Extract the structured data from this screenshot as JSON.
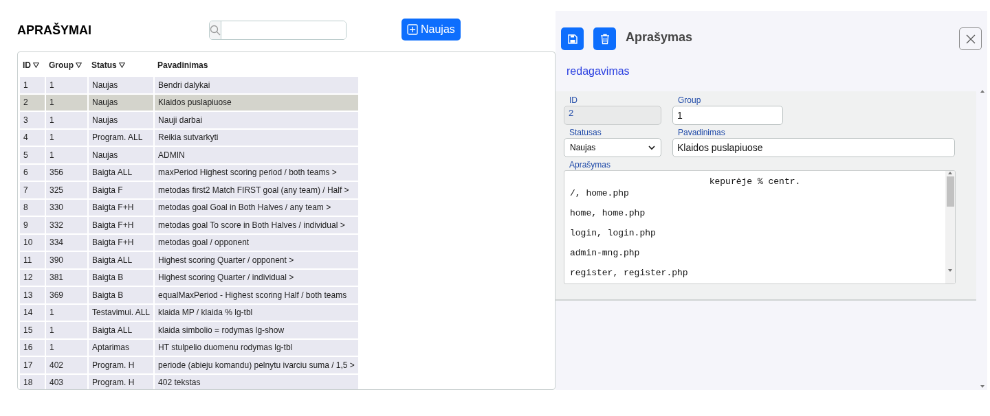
{
  "page": {
    "title": "APRAŠYMAI",
    "new_button": "Naujas"
  },
  "table": {
    "columns": [
      {
        "label": "ID",
        "sortable": true
      },
      {
        "label": "Group",
        "sortable": true
      },
      {
        "label": "Status",
        "sortable": true
      },
      {
        "label": "Pavadinimas",
        "sortable": false
      }
    ],
    "rows": [
      {
        "cells": [
          "1",
          "1",
          "Naujas",
          "Bendri dalykai"
        ],
        "selected": false
      },
      {
        "cells": [
          "2",
          "1",
          "Naujas",
          "Klaidos puslapiuose"
        ],
        "selected": true
      },
      {
        "cells": [
          "3",
          "1",
          "Naujas",
          "Nauji darbai"
        ],
        "selected": false
      },
      {
        "cells": [
          "4",
          "1",
          "Program. ALL",
          "Reikia sutvarkyti"
        ],
        "selected": false
      },
      {
        "cells": [
          "5",
          "1",
          "Naujas",
          "ADMIN"
        ],
        "selected": false
      },
      {
        "cells": [
          "6",
          "356",
          "Baigta ALL",
          "maxPeriod Highest scoring period / both teams >"
        ],
        "selected": false
      },
      {
        "cells": [
          "7",
          "325",
          "Baigta F",
          "metodas first2 Match FIRST goal (any team) / Half >"
        ],
        "selected": false
      },
      {
        "cells": [
          "8",
          "330",
          "Baigta F+H",
          "metodas goal Goal in Both Halves / any team >"
        ],
        "selected": false
      },
      {
        "cells": [
          "9",
          "332",
          "Baigta F+H",
          "metodas goal To score in Both Halves / individual >"
        ],
        "selected": false
      },
      {
        "cells": [
          "10",
          "334",
          "Baigta F+H",
          "metodas goal / opponent"
        ],
        "selected": false
      },
      {
        "cells": [
          "11",
          "390",
          "Baigta ALL",
          "Highest scoring Quarter / opponent >"
        ],
        "selected": false
      },
      {
        "cells": [
          "12",
          "381",
          "Baigta B",
          "Highest scoring Quarter / individual >"
        ],
        "selected": false
      },
      {
        "cells": [
          "13",
          "369",
          "Baigta B",
          "equalMaxPeriod - Highest scoring Half / both teams"
        ],
        "selected": false
      },
      {
        "cells": [
          "14",
          "1",
          "Testavimui. ALL",
          "klaida MP / klaida % lg-tbl"
        ],
        "selected": false
      },
      {
        "cells": [
          "15",
          "1",
          "Baigta ALL",
          "klaida simbolio = rodymas lg-show"
        ],
        "selected": false
      },
      {
        "cells": [
          "16",
          "1",
          "Aptarimas",
          "HT stulpelio duomenu rodymas lg-tbl"
        ],
        "selected": false
      },
      {
        "cells": [
          "17",
          "402",
          "Program. H",
          "periode (abieju komandu) pelnytu ivarciu suma / 1,5 >"
        ],
        "selected": false
      },
      {
        "cells": [
          "18",
          "403",
          "Program. H",
          "402 tekstas"
        ],
        "selected": false
      }
    ]
  },
  "editor": {
    "title": "Aprašymas",
    "subtitle": "redagavimas",
    "fields": {
      "id": {
        "label": "ID",
        "value": "2",
        "disabled": true
      },
      "group": {
        "label": "Group",
        "value": "1"
      },
      "status": {
        "label": "Statusas",
        "value": "Naujas"
      },
      "name": {
        "label": "Pavadinimas",
        "value": "Klaidos puslapiuose"
      }
    },
    "description": {
      "label": "Aprašymas",
      "lines": [
        {
          "text": "kepurėje % centr.",
          "kind": "centered"
        },
        {
          "text": "/, home.php",
          "kind": "plain"
        },
        {
          "text": "home, home.php",
          "kind": "plain"
        },
        {
          "text": "login, login.php",
          "kind": "plain"
        },
        {
          "text": "admin-mng.php",
          "kind": "plain"
        },
        {
          "text": "register, register.php",
          "kind": "plain"
        }
      ]
    }
  }
}
